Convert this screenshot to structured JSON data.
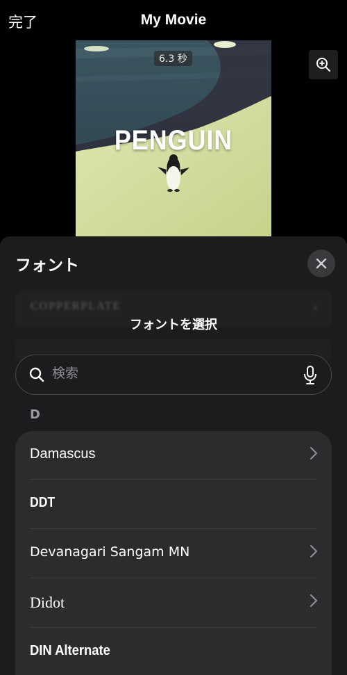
{
  "header": {
    "done_label": "完了",
    "title": "My Movie"
  },
  "preview": {
    "duration_label": "6.3 秒",
    "overlay_text": "PENGUIN"
  },
  "sheet": {
    "title": "フォント",
    "background_items": [
      "COPPERPLATE"
    ],
    "picker_title": "フォントを選択",
    "search": {
      "placeholder": "検索",
      "value": ""
    },
    "section_letter": "D",
    "fonts": [
      {
        "name": "Damascus",
        "has_chevron": true
      },
      {
        "name": "DDT",
        "has_chevron": false
      },
      {
        "name": "Devanagari Sangam MN",
        "has_chevron": true
      },
      {
        "name": "Didot",
        "has_chevron": true
      },
      {
        "name": "DIN Alternate",
        "has_chevron": false
      }
    ]
  },
  "colors": {
    "background": "#000000",
    "sheet": "#1c1c1e",
    "list_card": "#2c2c2e",
    "secondary_text": "#8e8e93"
  }
}
